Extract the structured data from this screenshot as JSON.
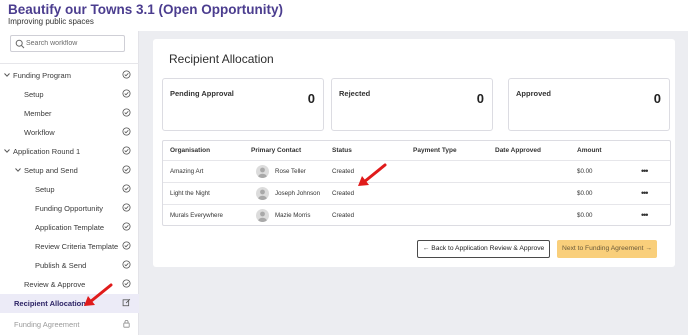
{
  "app": {
    "title": "Beautify our Towns 3.1 (Open Opportunity)",
    "subtitle": "Improving public spaces"
  },
  "sidebar": {
    "search_placeholder": "Search workflow",
    "items": [
      {
        "label": "Funding Program",
        "status": "complete",
        "level": 0,
        "expanded": true
      },
      {
        "label": "Setup",
        "status": "complete",
        "level": 1
      },
      {
        "label": "Member",
        "status": "complete",
        "level": 1
      },
      {
        "label": "Workflow",
        "status": "complete",
        "level": 1
      },
      {
        "label": "Application Round 1",
        "status": "complete",
        "level": 0,
        "expanded": true
      },
      {
        "label": "Setup and Send",
        "status": "complete",
        "level": 1,
        "expanded": true
      },
      {
        "label": "Setup",
        "status": "complete",
        "level": 2
      },
      {
        "label": "Funding Opportunity",
        "status": "complete",
        "level": 2
      },
      {
        "label": "Application Template",
        "status": "complete",
        "level": 2
      },
      {
        "label": "Review Criteria Template",
        "status": "complete",
        "level": 2
      },
      {
        "label": "Publish & Send",
        "status": "complete",
        "level": 2
      },
      {
        "label": "Review & Approve",
        "status": "complete",
        "level": 1
      },
      {
        "label": "Recipient Allocation",
        "status": "editing",
        "level": 1,
        "active": true
      },
      {
        "label": "Funding Agreement",
        "status": "locked",
        "level": 1
      }
    ]
  },
  "main": {
    "title": "Recipient Allocation",
    "summary": [
      {
        "label": "Pending Approval",
        "value": "0"
      },
      {
        "label": "Rejected",
        "value": "0"
      },
      {
        "label": "Approved",
        "value": "0"
      }
    ],
    "table": {
      "columns": [
        "Organisation",
        "Primary Contact",
        "Status",
        "Payment Type",
        "Date Approved",
        "Amount"
      ],
      "rows": [
        {
          "organisation": "Amazing Art",
          "contact": "Rose Teller",
          "status": "Created",
          "payment_type": "",
          "date_approved": "",
          "amount": "$0.00"
        },
        {
          "organisation": "Light the Night",
          "contact": "Joseph Johnson",
          "status": "Created",
          "payment_type": "",
          "date_approved": "",
          "amount": "$0.00"
        },
        {
          "organisation": "Murals Everywhere",
          "contact": "Mazie Morris",
          "status": "Created",
          "payment_type": "",
          "date_approved": "",
          "amount": "$0.00"
        }
      ],
      "row_action": "•••"
    },
    "back_button": "← Back to Application Review & Approve",
    "next_button": "Next to Funding Agreement →"
  },
  "colors": {
    "brand": "#4b3d8f",
    "content_bg": "#ecedf1",
    "active_nav_bg": "#ecebf7",
    "next_button_bg": "#f9cf7b",
    "annotation_arrow": "#e01b1b"
  }
}
